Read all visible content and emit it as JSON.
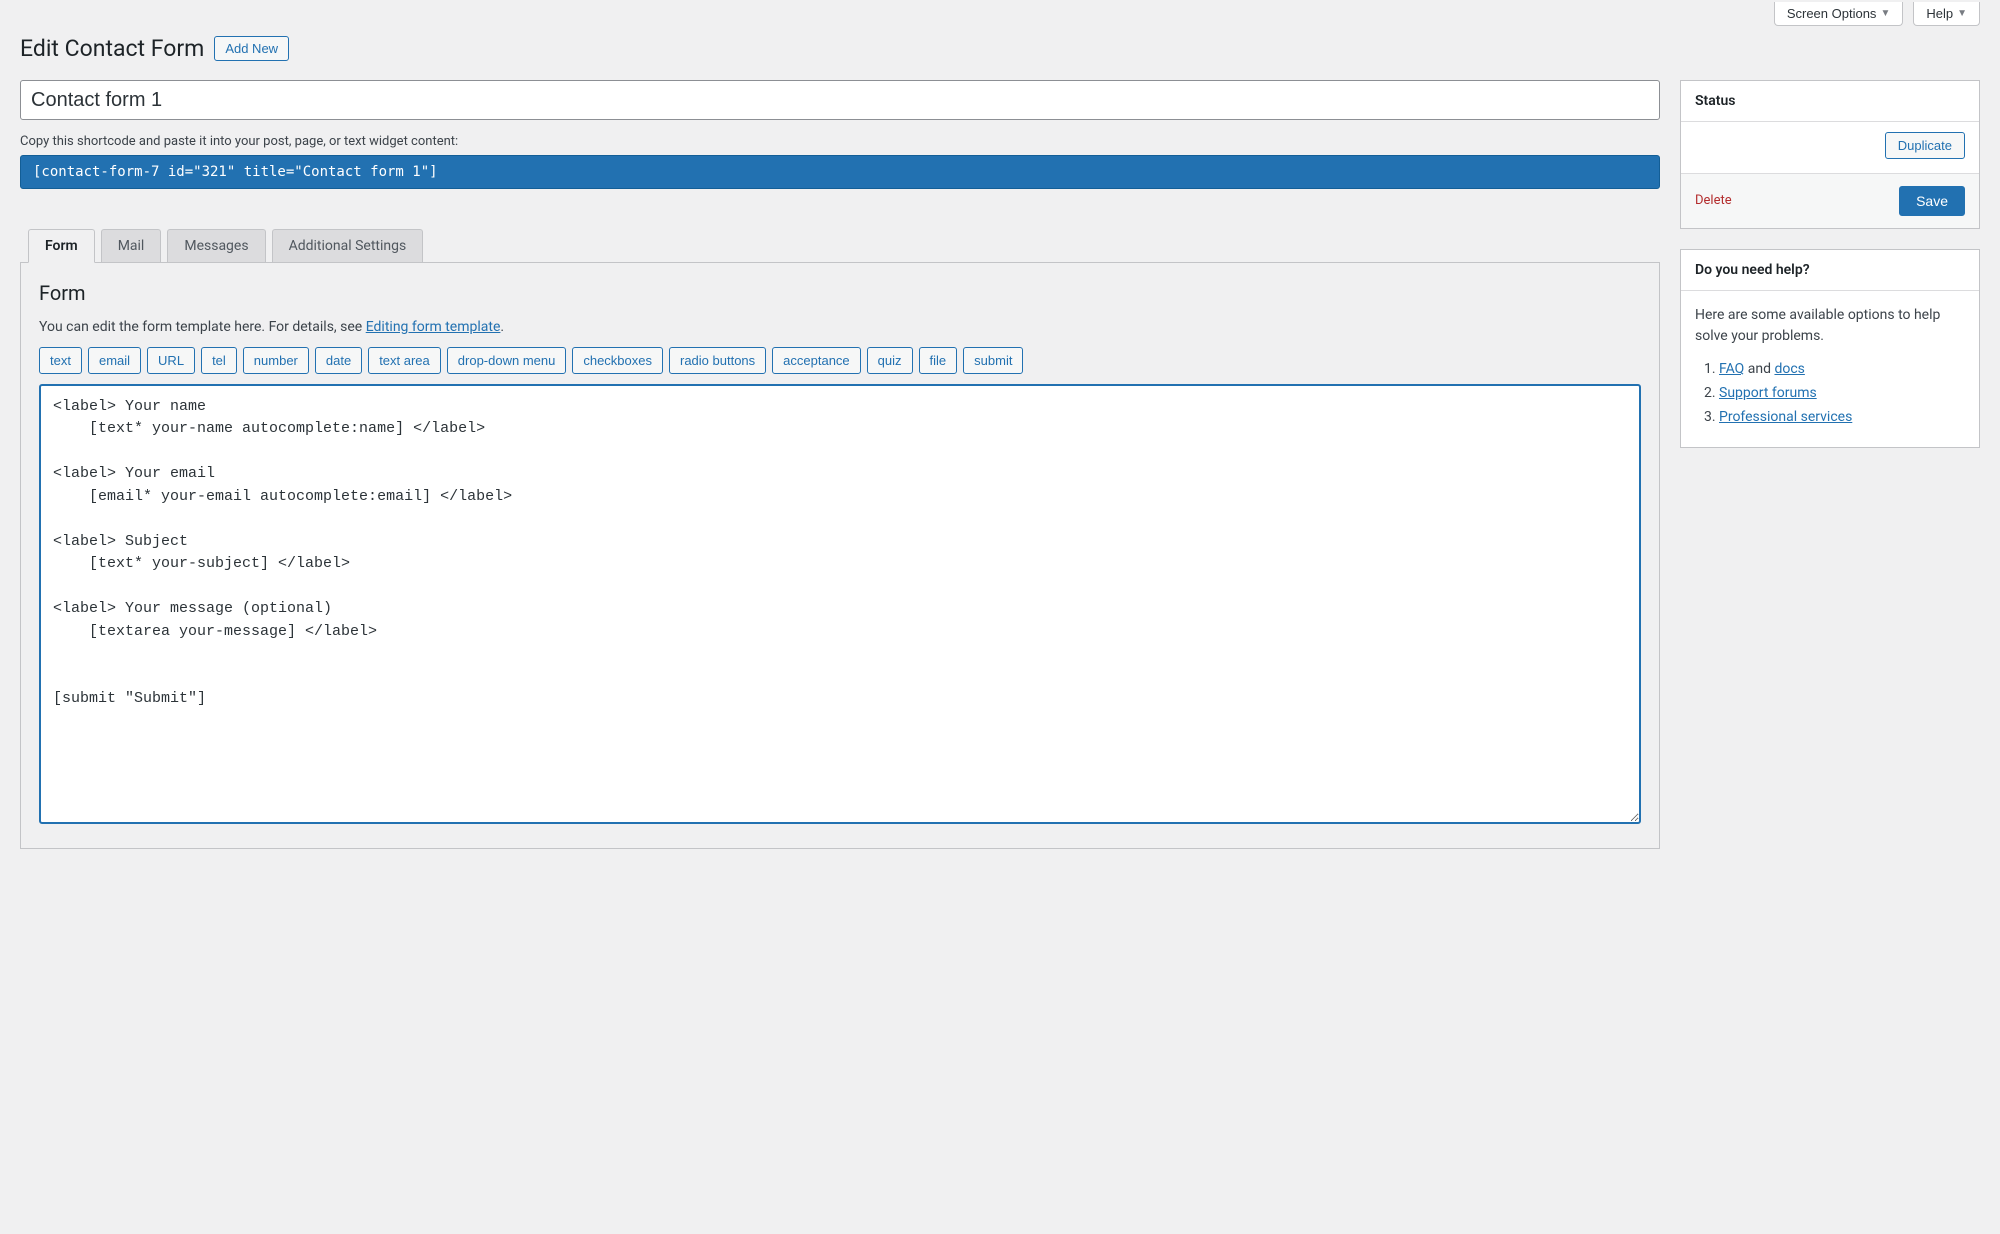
{
  "topButtons": {
    "screenOptions": "Screen Options",
    "help": "Help"
  },
  "header": {
    "title": "Edit Contact Form",
    "addNew": "Add New"
  },
  "form": {
    "titleValue": "Contact form 1",
    "shortcodeLabel": "Copy this shortcode and paste it into your post, page, or text widget content:",
    "shortcodeValue": "[contact-form-7 id=\"321\" title=\"Contact form 1\"]"
  },
  "tabs": {
    "form": "Form",
    "mail": "Mail",
    "messages": "Messages",
    "additional": "Additional Settings"
  },
  "panel": {
    "title": "Form",
    "descPrefix": "You can edit the form template here. For details, see ",
    "descLink": "Editing form template",
    "descSuffix": ".",
    "tagButtons": [
      "text",
      "email",
      "URL",
      "tel",
      "number",
      "date",
      "text area",
      "drop-down menu",
      "checkboxes",
      "radio buttons",
      "acceptance",
      "quiz",
      "file",
      "submit"
    ],
    "textareaValue": "<label> Your name\n    [text* your-name autocomplete:name] </label>\n\n<label> Your email\n    [email* your-email autocomplete:email] </label>\n\n<label> Subject\n    [text* your-subject] </label>\n\n<label> Your message (optional)\n    [textarea your-message] </label>\n\n\n[submit \"Submit\"]"
  },
  "statusBox": {
    "title": "Status",
    "duplicate": "Duplicate",
    "delete": "Delete",
    "save": "Save"
  },
  "helpBox": {
    "title": "Do you need help?",
    "intro": "Here are some available options to help solve your problems.",
    "items": {
      "faq": "FAQ",
      "and": " and ",
      "docs": "docs",
      "support": "Support forums",
      "pro": "Professional services"
    }
  }
}
